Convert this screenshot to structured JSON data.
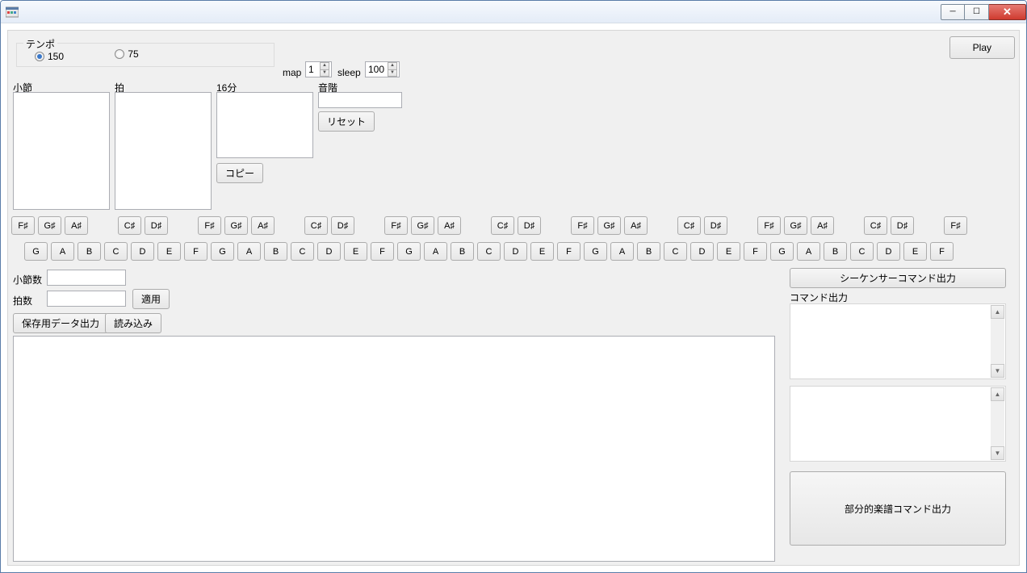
{
  "titlebar": {
    "title": ""
  },
  "play_button": "Play",
  "tempo_group": {
    "label": "テンポ",
    "opt1": "150",
    "opt2": "75"
  },
  "map_label": "map",
  "map_value": "1",
  "sleep_label": "sleep",
  "sleep_value": "100",
  "cols": {
    "bar": "小節",
    "beat": "拍",
    "sixteenth": "16分",
    "scale": "音階"
  },
  "copy_btn": "コピー",
  "reset_btn": "リセット",
  "sharp_row": [
    "F♯",
    "G♯",
    "A♯",
    "",
    "C♯",
    "D♯",
    "",
    "F♯",
    "G♯",
    "A♯",
    "",
    "C♯",
    "D♯",
    "",
    "F♯",
    "G♯",
    "A♯",
    "",
    "C♯",
    "D♯",
    "",
    "F♯",
    "G♯",
    "A♯",
    "",
    "C♯",
    "D♯",
    "",
    "F♯",
    "G♯",
    "A♯",
    "",
    "C♯",
    "D♯",
    "",
    "F♯"
  ],
  "natural_row": [
    "G",
    "A",
    "B",
    "C",
    "D",
    "E",
    "F",
    "G",
    "A",
    "B",
    "C",
    "D",
    "E",
    "F",
    "G",
    "A",
    "B",
    "C",
    "D",
    "E",
    "F",
    "G",
    "A",
    "B",
    "C",
    "D",
    "E",
    "F",
    "G",
    "A",
    "B",
    "C",
    "D",
    "E",
    "F"
  ],
  "bar_count_label": "小節数",
  "beat_count_label": "拍数",
  "apply_btn": "適用",
  "save_btn": "保存用データ出力",
  "load_btn": "読み込み",
  "seq_cmd_btn": "シーケンサーコマンド出力",
  "cmd_out_label": "コマンド出力",
  "partial_btn": "部分的楽譜コマンド出力"
}
